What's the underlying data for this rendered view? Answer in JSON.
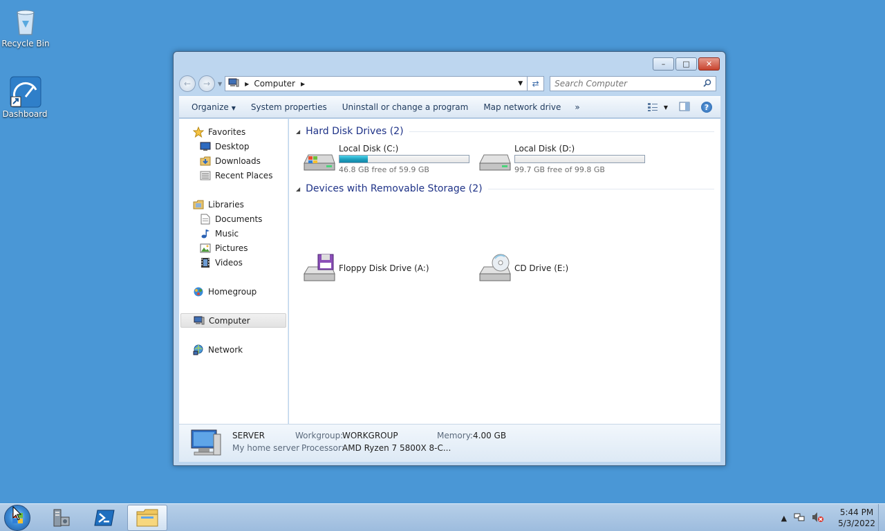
{
  "desktop": {
    "icons": [
      {
        "label": "Recycle Bin"
      },
      {
        "label": "Dashboard"
      }
    ]
  },
  "window": {
    "address": {
      "crumb": "Computer"
    },
    "search": {
      "placeholder": "Search Computer"
    },
    "toolbar": {
      "organize": "Organize",
      "system_properties": "System properties",
      "uninstall": "Uninstall or change a program",
      "map_drive": "Map network drive",
      "more": "»"
    },
    "navpane": {
      "favorites": "Favorites",
      "desktop": "Desktop",
      "downloads": "Downloads",
      "recent": "Recent Places",
      "libraries": "Libraries",
      "documents": "Documents",
      "music": "Music",
      "pictures": "Pictures",
      "videos": "Videos",
      "homegroup": "Homegroup",
      "computer": "Computer",
      "network": "Network"
    },
    "sections": {
      "hdd_title": "Hard Disk Drives (2)",
      "removable_title": "Devices with Removable Storage (2)"
    },
    "drives": {
      "c": {
        "name": "Local Disk (C:)",
        "free": "46.8 GB free of 59.9 GB",
        "used_fraction": 0.22
      },
      "d": {
        "name": "Local Disk (D:)",
        "free": "99.7 GB free of 99.8 GB",
        "used_fraction": 0.001
      },
      "a": {
        "name": "Floppy Disk Drive (A:)"
      },
      "e": {
        "name": "CD Drive (E:)"
      }
    },
    "details": {
      "computer_name": "SERVER",
      "description": "My home server",
      "workgroup_label": "Workgroup:",
      "workgroup_value": "WORKGROUP",
      "processor_label": "Processor:",
      "processor_value": "AMD Ryzen 7 5800X 8-C...",
      "memory_label": "Memory:",
      "memory_value": "4.00 GB"
    }
  },
  "taskbar": {
    "time": "5:44 PM",
    "date": "5/3/2022"
  },
  "colors": {
    "desktop": "#4a97d6",
    "accent": "#1e3287",
    "drive_bar": "#1d9fbe"
  }
}
